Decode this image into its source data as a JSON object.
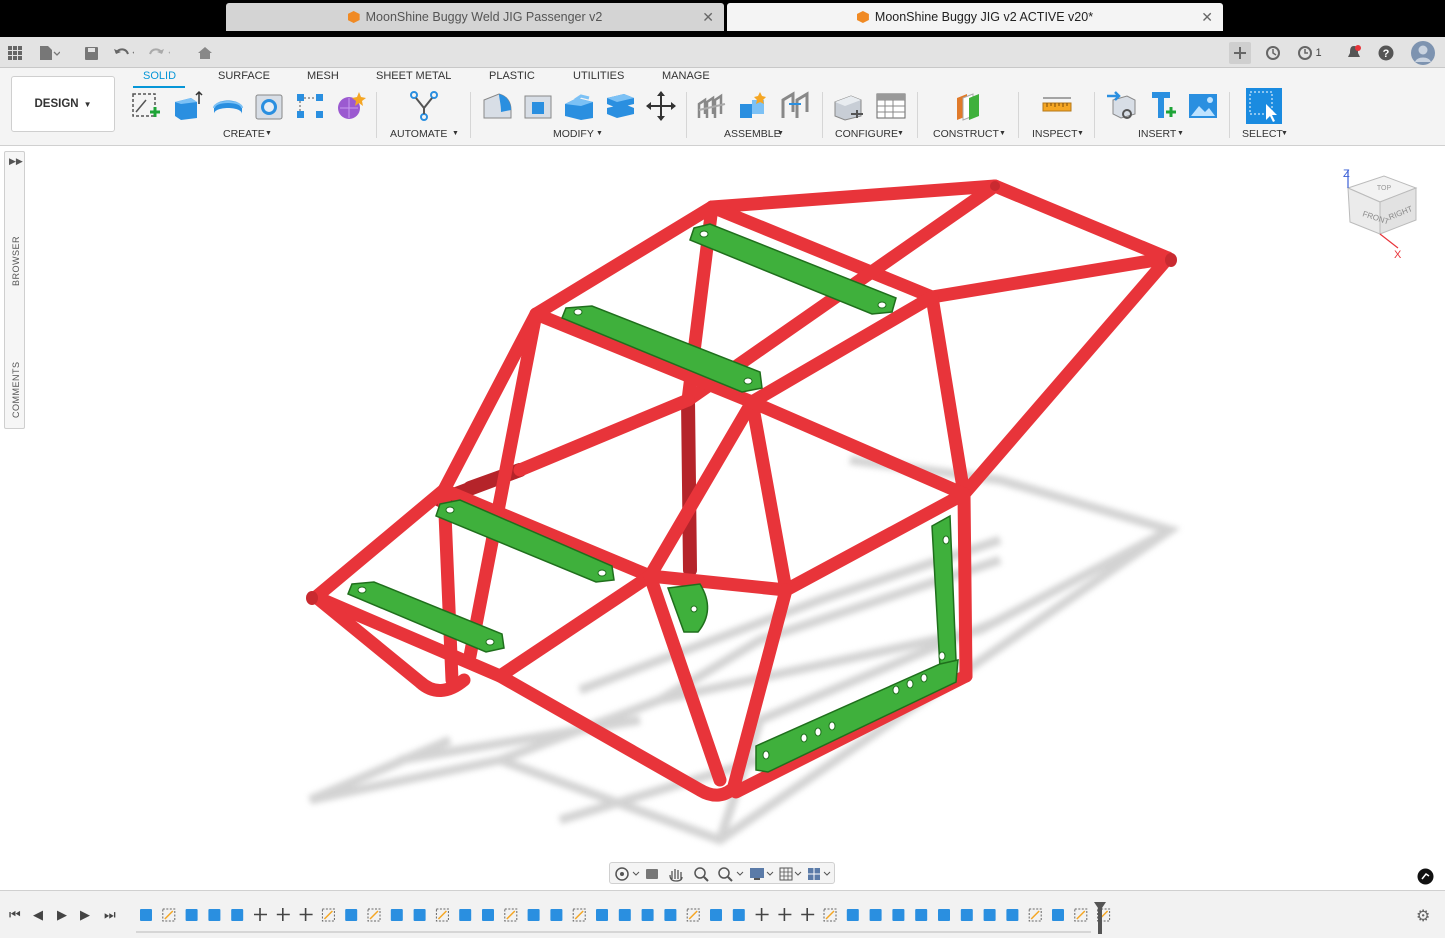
{
  "tabs": [
    {
      "label": "MoonShine Buggy Weld JIG Passenger v2",
      "active": false
    },
    {
      "label": "MoonShine Buggy JIG v2 ACTIVE v20*",
      "active": true
    }
  ],
  "header": {
    "job_count": "1"
  },
  "workspace": {
    "label": "DESIGN"
  },
  "ribbon_tabs": [
    "SOLID",
    "SURFACE",
    "MESH",
    "SHEET METAL",
    "PLASTIC",
    "UTILITIES",
    "MANAGE"
  ],
  "groups": [
    "CREATE",
    "AUTOMATE",
    "MODIFY",
    "ASSEMBLE",
    "CONFIGURE",
    "CONSTRUCT",
    "INSPECT",
    "INSERT",
    "SELECT"
  ],
  "side": {
    "browser": "BROWSER",
    "comments": "COMMENTS"
  },
  "viewcube": {
    "top": "TOP",
    "front": "FRONT",
    "right": "RIGHT",
    "z": "Z",
    "x": "X"
  },
  "colors": {
    "frame": "#e8343a",
    "plate": "#3fb03c",
    "accent": "#0696d7"
  }
}
